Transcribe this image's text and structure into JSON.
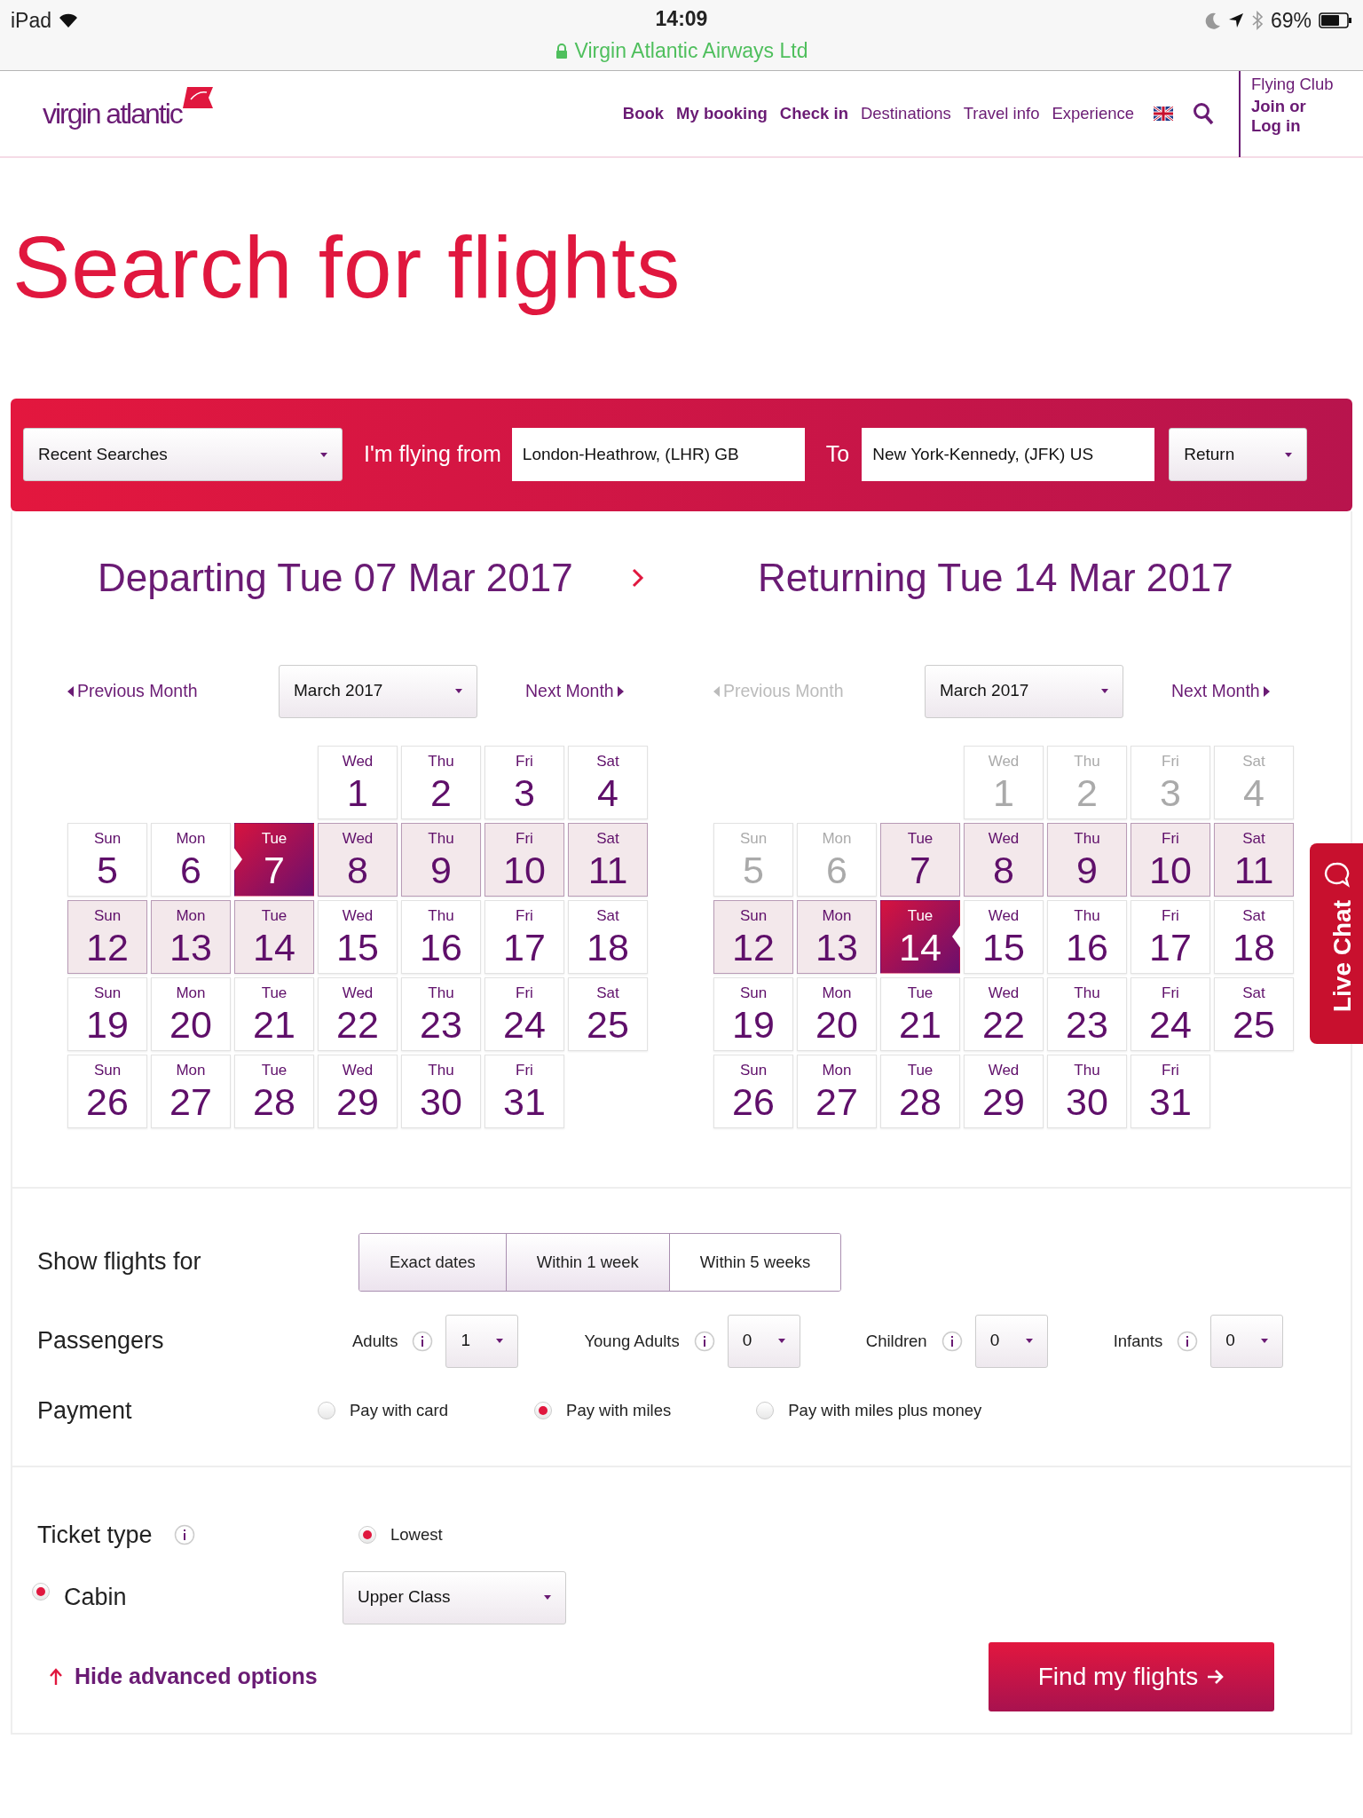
{
  "status_bar": {
    "device": "iPad",
    "time": "14:09",
    "site": "Virgin Atlantic Airways Ltd",
    "battery": "69%"
  },
  "header": {
    "logo": "virgin atlantic",
    "nav": [
      {
        "label": "Book",
        "emphasis": true
      },
      {
        "label": "My booking",
        "emphasis": true
      },
      {
        "label": "Check in",
        "emphasis": true
      },
      {
        "label": "Destinations",
        "emphasis": false
      },
      {
        "label": "Travel info",
        "emphasis": false
      },
      {
        "label": "Experience",
        "emphasis": false
      }
    ],
    "club": {
      "title": "Flying Club",
      "links": [
        "Join or",
        "Log in"
      ]
    }
  },
  "page_title": "Search for flights",
  "search_bar": {
    "recent": "Recent Searches",
    "from_label": "I'm flying from",
    "from": "London-Heathrow, (LHR) GB",
    "to_label": "To",
    "to": "New York-Kennedy, (JFK) US",
    "trip": "Return"
  },
  "calendars": [
    {
      "kind": "departing",
      "title": "Departing Tue 07 Mar 2017",
      "prev": {
        "label": "Previous Month",
        "disabled": false
      },
      "month": "March 2017",
      "next": {
        "label": "Next Month",
        "disabled": false
      },
      "weeks": [
        [
          {
            "weekday": "Wed",
            "day": "1",
            "selected": false,
            "in_range": false,
            "disabled": false
          },
          {
            "weekday": "Thu",
            "day": "2",
            "selected": false,
            "in_range": false,
            "disabled": false
          },
          {
            "weekday": "Fri",
            "day": "3",
            "selected": false,
            "in_range": false,
            "disabled": false
          },
          {
            "weekday": "Sat",
            "day": "4",
            "selected": false,
            "in_range": false,
            "disabled": false
          }
        ],
        [
          {
            "weekday": "Sun",
            "day": "5",
            "selected": false,
            "in_range": false,
            "disabled": false
          },
          {
            "weekday": "Mon",
            "day": "6",
            "selected": false,
            "in_range": false,
            "disabled": false
          },
          {
            "weekday": "Tue",
            "day": "7",
            "selected": true,
            "in_range": false,
            "disabled": false
          },
          {
            "weekday": "Wed",
            "day": "8",
            "selected": false,
            "in_range": true,
            "disabled": false
          },
          {
            "weekday": "Thu",
            "day": "9",
            "selected": false,
            "in_range": true,
            "disabled": false
          },
          {
            "weekday": "Fri",
            "day": "10",
            "selected": false,
            "in_range": true,
            "disabled": false
          },
          {
            "weekday": "Sat",
            "day": "11",
            "selected": false,
            "in_range": true,
            "disabled": false
          }
        ],
        [
          {
            "weekday": "Sun",
            "day": "12",
            "selected": false,
            "in_range": true,
            "disabled": false
          },
          {
            "weekday": "Mon",
            "day": "13",
            "selected": false,
            "in_range": true,
            "disabled": false
          },
          {
            "weekday": "Tue",
            "day": "14",
            "selected": false,
            "in_range": true,
            "disabled": false
          },
          {
            "weekday": "Wed",
            "day": "15",
            "selected": false,
            "in_range": false,
            "disabled": false
          },
          {
            "weekday": "Thu",
            "day": "16",
            "selected": false,
            "in_range": false,
            "disabled": false
          },
          {
            "weekday": "Fri",
            "day": "17",
            "selected": false,
            "in_range": false,
            "disabled": false
          },
          {
            "weekday": "Sat",
            "day": "18",
            "selected": false,
            "in_range": false,
            "disabled": false
          }
        ],
        [
          {
            "weekday": "Sun",
            "day": "19",
            "selected": false,
            "in_range": false,
            "disabled": false
          },
          {
            "weekday": "Mon",
            "day": "20",
            "selected": false,
            "in_range": false,
            "disabled": false
          },
          {
            "weekday": "Tue",
            "day": "21",
            "selected": false,
            "in_range": false,
            "disabled": false
          },
          {
            "weekday": "Wed",
            "day": "22",
            "selected": false,
            "in_range": false,
            "disabled": false
          },
          {
            "weekday": "Thu",
            "day": "23",
            "selected": false,
            "in_range": false,
            "disabled": false
          },
          {
            "weekday": "Fri",
            "day": "24",
            "selected": false,
            "in_range": false,
            "disabled": false
          },
          {
            "weekday": "Sat",
            "day": "25",
            "selected": false,
            "in_range": false,
            "disabled": false
          }
        ],
        [
          {
            "weekday": "Sun",
            "day": "26",
            "selected": false,
            "in_range": false,
            "disabled": false
          },
          {
            "weekday": "Mon",
            "day": "27",
            "selected": false,
            "in_range": false,
            "disabled": false
          },
          {
            "weekday": "Tue",
            "day": "28",
            "selected": false,
            "in_range": false,
            "disabled": false
          },
          {
            "weekday": "Wed",
            "day": "29",
            "selected": false,
            "in_range": false,
            "disabled": false
          },
          {
            "weekday": "Thu",
            "day": "30",
            "selected": false,
            "in_range": false,
            "disabled": false
          },
          {
            "weekday": "Fri",
            "day": "31",
            "selected": false,
            "in_range": false,
            "disabled": false
          }
        ]
      ]
    },
    {
      "kind": "returning",
      "title": "Returning Tue 14 Mar 2017",
      "prev": {
        "label": "Previous Month",
        "disabled": true
      },
      "month": "March 2017",
      "next": {
        "label": "Next Month",
        "disabled": false
      },
      "weeks": [
        [
          {
            "weekday": "Wed",
            "day": "1",
            "selected": false,
            "in_range": false,
            "disabled": true
          },
          {
            "weekday": "Thu",
            "day": "2",
            "selected": false,
            "in_range": false,
            "disabled": true
          },
          {
            "weekday": "Fri",
            "day": "3",
            "selected": false,
            "in_range": false,
            "disabled": true
          },
          {
            "weekday": "Sat",
            "day": "4",
            "selected": false,
            "in_range": false,
            "disabled": true
          }
        ],
        [
          {
            "weekday": "Sun",
            "day": "5",
            "selected": false,
            "in_range": false,
            "disabled": true
          },
          {
            "weekday": "Mon",
            "day": "6",
            "selected": false,
            "in_range": false,
            "disabled": true
          },
          {
            "weekday": "Tue",
            "day": "7",
            "selected": false,
            "in_range": true,
            "disabled": false
          },
          {
            "weekday": "Wed",
            "day": "8",
            "selected": false,
            "in_range": true,
            "disabled": false
          },
          {
            "weekday": "Thu",
            "day": "9",
            "selected": false,
            "in_range": true,
            "disabled": false
          },
          {
            "weekday": "Fri",
            "day": "10",
            "selected": false,
            "in_range": true,
            "disabled": false
          },
          {
            "weekday": "Sat",
            "day": "11",
            "selected": false,
            "in_range": true,
            "disabled": false
          }
        ],
        [
          {
            "weekday": "Sun",
            "day": "12",
            "selected": false,
            "in_range": true,
            "disabled": false
          },
          {
            "weekday": "Mon",
            "day": "13",
            "selected": false,
            "in_range": true,
            "disabled": false
          },
          {
            "weekday": "Tue",
            "day": "14",
            "selected": true,
            "in_range": false,
            "disabled": false
          },
          {
            "weekday": "Wed",
            "day": "15",
            "selected": false,
            "in_range": false,
            "disabled": false
          },
          {
            "weekday": "Thu",
            "day": "16",
            "selected": false,
            "in_range": false,
            "disabled": false
          },
          {
            "weekday": "Fri",
            "day": "17",
            "selected": false,
            "in_range": false,
            "disabled": false
          },
          {
            "weekday": "Sat",
            "day": "18",
            "selected": false,
            "in_range": false,
            "disabled": false
          }
        ],
        [
          {
            "weekday": "Sun",
            "day": "19",
            "selected": false,
            "in_range": false,
            "disabled": false
          },
          {
            "weekday": "Mon",
            "day": "20",
            "selected": false,
            "in_range": false,
            "disabled": false
          },
          {
            "weekday": "Tue",
            "day": "21",
            "selected": false,
            "in_range": false,
            "disabled": false
          },
          {
            "weekday": "Wed",
            "day": "22",
            "selected": false,
            "in_range": false,
            "disabled": false
          },
          {
            "weekday": "Thu",
            "day": "23",
            "selected": false,
            "in_range": false,
            "disabled": false
          },
          {
            "weekday": "Fri",
            "day": "24",
            "selected": false,
            "in_range": false,
            "disabled": false
          },
          {
            "weekday": "Sat",
            "day": "25",
            "selected": false,
            "in_range": false,
            "disabled": false
          }
        ],
        [
          {
            "weekday": "Sun",
            "day": "26",
            "selected": false,
            "in_range": false,
            "disabled": false
          },
          {
            "weekday": "Mon",
            "day": "27",
            "selected": false,
            "in_range": false,
            "disabled": false
          },
          {
            "weekday": "Tue",
            "day": "28",
            "selected": false,
            "in_range": false,
            "disabled": false
          },
          {
            "weekday": "Wed",
            "day": "29",
            "selected": false,
            "in_range": false,
            "disabled": false
          },
          {
            "weekday": "Thu",
            "day": "30",
            "selected": false,
            "in_range": false,
            "disabled": false
          },
          {
            "weekday": "Fri",
            "day": "31",
            "selected": false,
            "in_range": false,
            "disabled": false
          }
        ]
      ]
    }
  ],
  "live_chat": "Live Chat",
  "show_flights_for": {
    "label": "Show flights for",
    "options": [
      {
        "label": "Exact dates",
        "selected": false
      },
      {
        "label": "Within 1 week",
        "selected": false
      },
      {
        "label": "Within 5 weeks",
        "selected": true
      }
    ]
  },
  "passengers": {
    "label": "Passengers",
    "groups": [
      {
        "label": "Adults",
        "value": "1"
      },
      {
        "label": "Young Adults",
        "value": "0"
      },
      {
        "label": "Children",
        "value": "0"
      },
      {
        "label": "Infants",
        "value": "0"
      }
    ]
  },
  "payment": {
    "label": "Payment",
    "options": [
      {
        "label": "Pay with card",
        "selected": false
      },
      {
        "label": "Pay with miles",
        "selected": true
      },
      {
        "label": "Pay with miles plus money",
        "selected": false
      }
    ]
  },
  "ticket_type": {
    "label": "Ticket type",
    "options": [
      {
        "label": "Lowest",
        "selected": true
      }
    ]
  },
  "cabin": {
    "label": "Cabin",
    "selected": true,
    "value": "Upper Class"
  },
  "hide_advanced": "Hide advanced options",
  "submit": "Find my flights"
}
